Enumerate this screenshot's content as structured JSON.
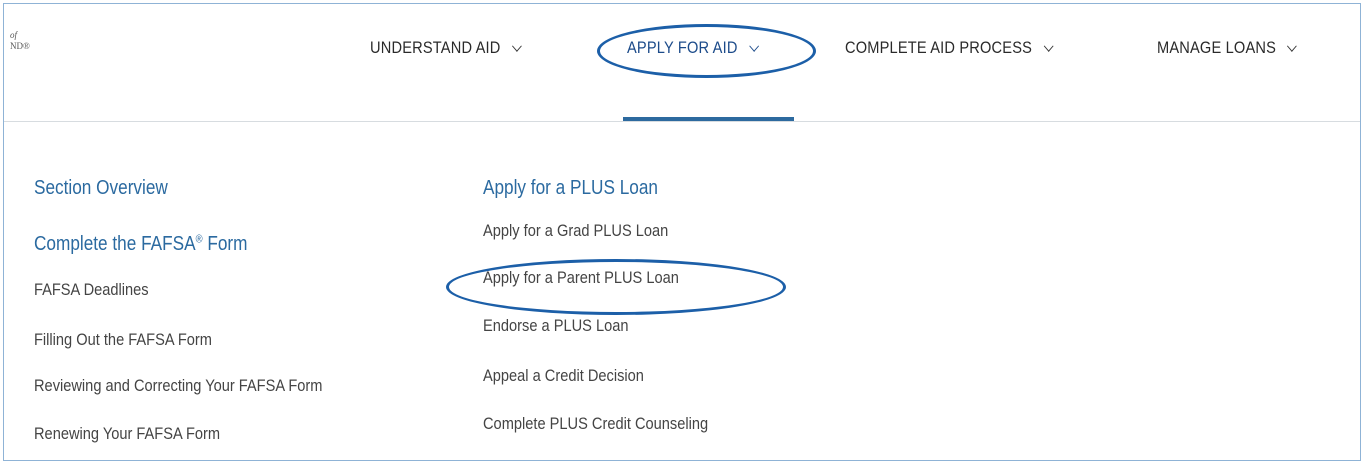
{
  "logo": {
    "line1": "of",
    "line2": "ND®"
  },
  "nav": {
    "items": [
      {
        "label": "UNDERSTAND AID"
      },
      {
        "label": "APPLY FOR AID"
      },
      {
        "label": "COMPLETE AID PROCESS"
      },
      {
        "label": "MANAGE LOANS"
      }
    ],
    "active_index": 1
  },
  "dropdown": {
    "column1": {
      "section_overview": "Section Overview",
      "fafsa_heading": "Complete the FAFSA",
      "fafsa_heading_mark": "®",
      "fafsa_heading_suffix": " Form",
      "links": [
        "FAFSA Deadlines",
        "Filling Out the FAFSA Form",
        "Reviewing and Correcting Your FAFSA Form",
        "Renewing Your FAFSA Form"
      ]
    },
    "column2": {
      "heading": "Apply for a PLUS Loan",
      "links": [
        "Apply for a Grad PLUS Loan",
        "Apply for a Parent PLUS Loan",
        "Endorse a PLUS Loan",
        "Appeal a Credit Decision",
        "Complete PLUS Credit Counseling"
      ]
    }
  },
  "annotations": {
    "highlight_color": "#1c5fa8"
  }
}
